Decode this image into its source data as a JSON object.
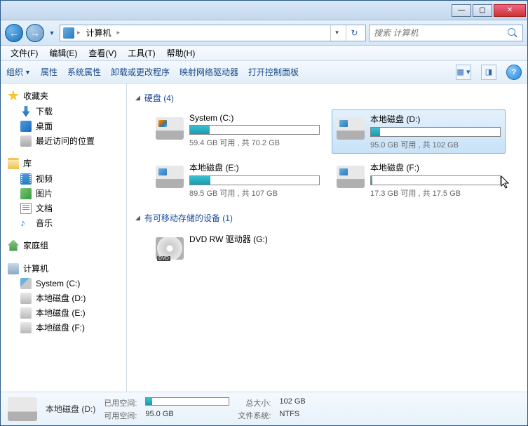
{
  "titlebar": {
    "min": "—",
    "max": "▢",
    "close": "✕"
  },
  "nav": {
    "root": "计算机",
    "refresh": "↻",
    "search_placeholder": "搜索 计算机"
  },
  "menu": {
    "file": "文件(F)",
    "edit": "编辑(E)",
    "view": "查看(V)",
    "tools": "工具(T)",
    "help": "帮助(H)"
  },
  "toolbar": {
    "org": "组织",
    "props": "属性",
    "sysprops": "系统属性",
    "uninstall": "卸载或更改程序",
    "netdrv": "映射网络驱动器",
    "cpanel": "打开控制面板"
  },
  "sidebar": {
    "fav": "收藏夹",
    "dl": "下载",
    "desk": "桌面",
    "recent": "最近访问的位置",
    "lib": "库",
    "vid": "视频",
    "pic": "图片",
    "doc": "文档",
    "mus": "音乐",
    "home": "家庭组",
    "comp": "计算机",
    "c": "System (C:)",
    "d": "本地磁盘 (D:)",
    "e": "本地磁盘 (E:)",
    "f": "本地磁盘 (F:)"
  },
  "sections": {
    "hdd": "硬盘 (4)",
    "removable": "有可移动存储的设备 (1)"
  },
  "drives": {
    "c": {
      "name": "System (C:)",
      "stat": "59.4 GB 可用 , 共 70.2 GB",
      "pct": 15
    },
    "d": {
      "name": "本地磁盘 (D:)",
      "stat": "95.0 GB 可用 , 共 102 GB",
      "pct": 7
    },
    "e": {
      "name": "本地磁盘 (E:)",
      "stat": "89.5 GB 可用 , 共 107 GB",
      "pct": 16
    },
    "f": {
      "name": "本地磁盘 (F:)",
      "stat": "17.3 GB 可用 , 共 17.5 GB",
      "pct": 1
    },
    "g": {
      "name": "DVD RW 驱动器 (G:)"
    }
  },
  "status": {
    "name": "本地磁盘 (D:)",
    "used_lbl": "已用空间:",
    "used_pct": 7,
    "free_lbl": "可用空间:",
    "free": "95.0 GB",
    "size_lbl": "总大小:",
    "size": "102 GB",
    "fs_lbl": "文件系统:",
    "fs": "NTFS"
  }
}
